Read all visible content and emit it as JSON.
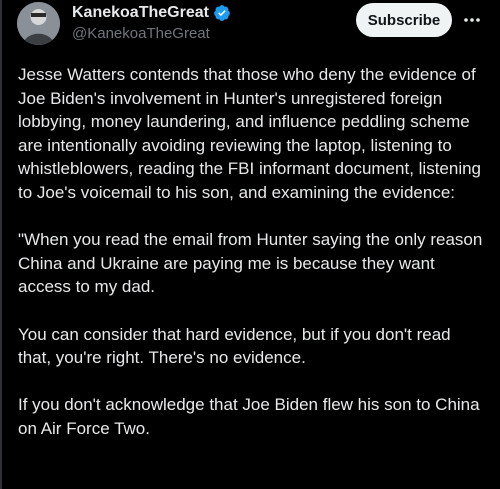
{
  "author": {
    "display_name": "KanekoaTheGreat",
    "handle": "@KanekoaTheGreat",
    "verified": true,
    "avatar_icon": "profile-avatar"
  },
  "actions": {
    "subscribe_label": "Subscribe",
    "more_icon": "more-horizontal-icon"
  },
  "colors": {
    "background": "#000000",
    "text": "#e7e9ea",
    "secondary_text": "#71767b",
    "verified_badge": "#1d9bf0",
    "button_bg": "#eff3f4"
  },
  "tweet": {
    "paragraphs": [
      "Jesse Watters contends that those who deny the evidence of Joe Biden's involvement in Hunter's unregistered foreign lobbying, money laundering, and influence peddling scheme are intentionally avoiding reviewing the laptop, listening to whistleblowers, reading the FBI informant document, listening to Joe's voicemail to his son, and examining the evidence:",
      "\"When you read the email from Hunter saying the only reason China and Ukraine are paying me is because they want access to my dad.",
      "You can consider that hard evidence, but if you don't read that, you're right. There's no evidence.",
      "If you don't acknowledge that Joe Biden flew his son to China on Air Force Two."
    ]
  }
}
